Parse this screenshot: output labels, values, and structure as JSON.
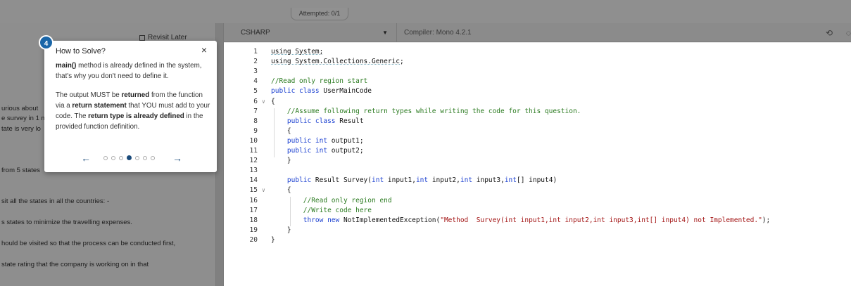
{
  "header": {
    "attempted": "Attempted: 0/1"
  },
  "question": {
    "revisit_later": "Revisit Later",
    "fragments": [
      "urious about",
      "e survey in 1 m",
      "tate is very lo",
      "from 5 states",
      "sit all the states in all the countries: -",
      "s states to minimize the travelling expenses.",
      "hould be visited so that the process can be conducted first,",
      "state rating that the company is working on in that"
    ]
  },
  "editor": {
    "language": "CSHARP",
    "compiler": "Compiler: Mono 4.2.1",
    "reset_icon": "reset-icon",
    "settings_icon": "settings-icon"
  },
  "code": {
    "lines": [
      {
        "n": "1",
        "fold": "",
        "parts": [
          {
            "t": "using System;",
            "c": "squig"
          }
        ]
      },
      {
        "n": "2",
        "fold": "",
        "parts": [
          {
            "t": "using System.Collections.Generic;",
            "c": "squig"
          }
        ]
      },
      {
        "n": "3",
        "fold": "",
        "parts": []
      },
      {
        "n": "4",
        "fold": "",
        "parts": [
          {
            "t": "//Read only region start",
            "c": "cm"
          }
        ]
      },
      {
        "n": "5",
        "fold": "",
        "parts": [
          {
            "t": "public class ",
            "c": "kw"
          },
          {
            "t": "UserMainCode",
            "c": ""
          }
        ]
      },
      {
        "n": "6",
        "fold": "v",
        "parts": [
          {
            "t": "{",
            "c": ""
          }
        ]
      },
      {
        "n": "7",
        "fold": "",
        "parts": [
          {
            "t": "    //Assume following return types while writing the code for this question.",
            "c": "cm"
          }
        ]
      },
      {
        "n": "8",
        "fold": "",
        "parts": [
          {
            "t": "    public class ",
            "c": "kw"
          },
          {
            "t": "Result",
            "c": ""
          }
        ]
      },
      {
        "n": "9",
        "fold": "",
        "parts": [
          {
            "t": "    {",
            "c": ""
          }
        ]
      },
      {
        "n": "10",
        "fold": "",
        "parts": [
          {
            "t": "    public int ",
            "c": "kw"
          },
          {
            "t": "output1;",
            "c": ""
          }
        ]
      },
      {
        "n": "11",
        "fold": "",
        "parts": [
          {
            "t": "    public int ",
            "c": "kw"
          },
          {
            "t": "output2;",
            "c": ""
          }
        ]
      },
      {
        "n": "12",
        "fold": "",
        "parts": [
          {
            "t": "    }",
            "c": ""
          }
        ]
      },
      {
        "n": "13",
        "fold": "",
        "parts": []
      },
      {
        "n": "14",
        "fold": "",
        "parts": [
          {
            "t": "    public ",
            "c": "kw"
          },
          {
            "t": "Result Survey(",
            "c": ""
          },
          {
            "t": "int ",
            "c": "kw"
          },
          {
            "t": "input1,",
            "c": ""
          },
          {
            "t": "int ",
            "c": "kw"
          },
          {
            "t": "input2,",
            "c": ""
          },
          {
            "t": "int ",
            "c": "kw"
          },
          {
            "t": "input3,",
            "c": ""
          },
          {
            "t": "int",
            "c": "kw"
          },
          {
            "t": "[] input4)",
            "c": ""
          }
        ]
      },
      {
        "n": "15",
        "fold": "v",
        "parts": [
          {
            "t": "    {",
            "c": ""
          }
        ]
      },
      {
        "n": "16",
        "fold": "",
        "parts": [
          {
            "t": "        //Read only region end",
            "c": "cm"
          }
        ]
      },
      {
        "n": "17",
        "fold": "",
        "parts": [
          {
            "t": "        //Write code here",
            "c": "cm"
          }
        ]
      },
      {
        "n": "18",
        "fold": "",
        "parts": [
          {
            "t": "        throw new ",
            "c": "kw"
          },
          {
            "t": "NotImplementedException(",
            "c": ""
          },
          {
            "t": "\"Method  Survey(int input1,int input2,int input3,int[] input4) not Implemented.\"",
            "c": "st"
          },
          {
            "t": ");",
            "c": ""
          }
        ]
      },
      {
        "n": "19",
        "fold": "",
        "parts": [
          {
            "t": "    }",
            "c": ""
          }
        ]
      },
      {
        "n": "20",
        "fold": "",
        "parts": [
          {
            "t": "}",
            "c": ""
          }
        ]
      }
    ]
  },
  "tooltip": {
    "step": "4",
    "title": "How to Solve?",
    "close": "×",
    "p1": [
      {
        "t": "main()",
        "b": true
      },
      {
        "t": " method is already defined in the system, that's why you don't need to define it.",
        "b": false
      }
    ],
    "p2": [
      {
        "t": "The output MUST be ",
        "b": false
      },
      {
        "t": "returned",
        "b": true
      },
      {
        "t": " from the function via a ",
        "b": false
      },
      {
        "t": "return statement",
        "b": true
      },
      {
        "t": " that YOU must add to your code. The ",
        "b": false
      },
      {
        "t": "return type is already defined",
        "b": true
      },
      {
        "t": " in the provided function definition.",
        "b": false
      }
    ],
    "prev": "←",
    "next": "→",
    "dots_total": 7,
    "dots_active": 3
  }
}
